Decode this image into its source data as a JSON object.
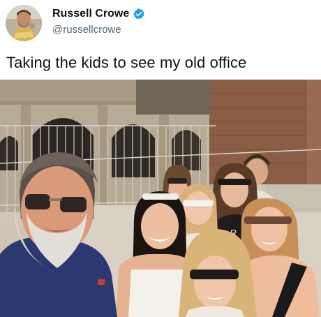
{
  "tweet": {
    "display_name": "Russell Crowe",
    "handle": "@russellcrowe",
    "verified": true,
    "text": "Taking the kids to see my old office",
    "avatar_icon": "profile-avatar",
    "verified_icon": "verified-badge-icon",
    "accent_color": "#1d9bf0"
  },
  "photo": {
    "shirt_letters": "R"
  }
}
